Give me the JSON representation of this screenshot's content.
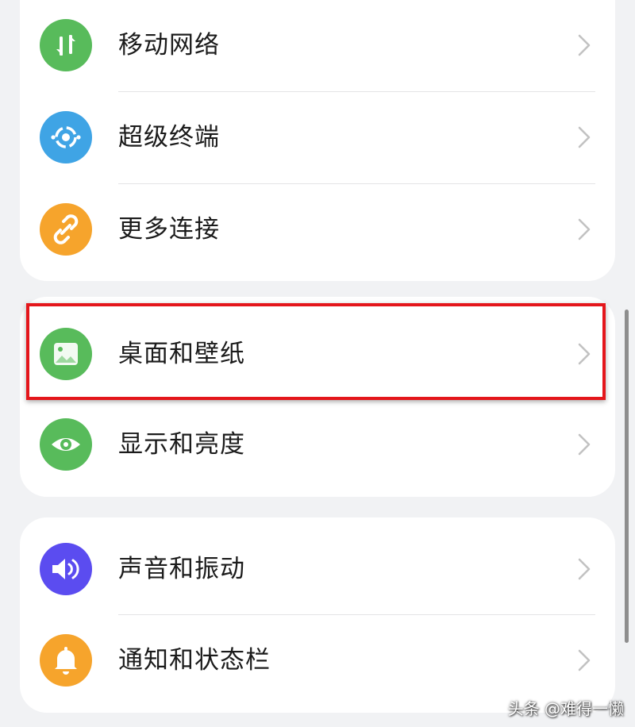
{
  "groups": [
    {
      "items": [
        {
          "label": "移动网络",
          "icon": "mobile-network-icon",
          "color": "#58bb5b"
        },
        {
          "label": "超级终端",
          "icon": "super-device-icon",
          "color": "#3fa4e5"
        },
        {
          "label": "更多连接",
          "icon": "link-icon",
          "color": "#f6a42c"
        }
      ]
    },
    {
      "items": [
        {
          "label": "桌面和壁纸",
          "icon": "wallpaper-icon",
          "color": "#58bb5b"
        },
        {
          "label": "显示和亮度",
          "icon": "eye-icon",
          "color": "#58bb5b"
        }
      ]
    },
    {
      "items": [
        {
          "label": "声音和振动",
          "icon": "speaker-icon",
          "color": "#5b4cf0"
        },
        {
          "label": "通知和状态栏",
          "icon": "bell-icon",
          "color": "#f6a42c"
        }
      ]
    }
  ],
  "highlight": {
    "color": "#e4161b"
  },
  "watermark": "头条 @难得一懒"
}
